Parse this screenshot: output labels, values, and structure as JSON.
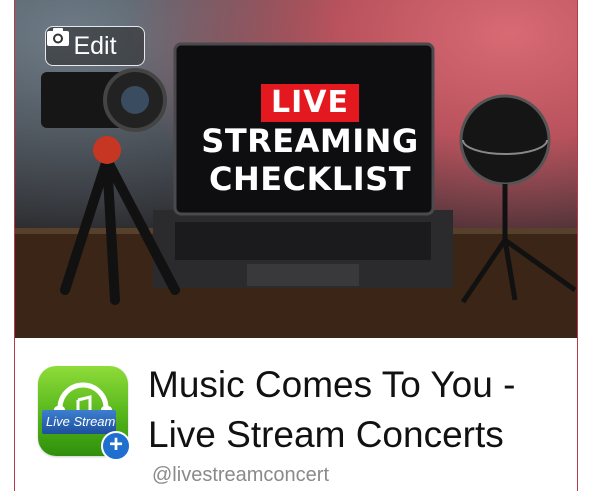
{
  "cover": {
    "edit_label": "Edit",
    "screen_badge": "LIVE",
    "screen_line1": "STREAMING",
    "screen_line2": "CHECKLIST"
  },
  "profile": {
    "icon_text": "Live Stream",
    "plus_symbol": "+",
    "name_line1": "Music Comes To You -",
    "name_line2": "Live Stream Concerts",
    "handle": "@livestreamconcert"
  },
  "icons": {
    "edit": "camera-icon",
    "app": "headphones-music-icon",
    "add": "plus-icon"
  },
  "colors": {
    "frame": "#b73a4a",
    "live_badge": "#e3191f",
    "icon_green": "#55b51a",
    "plus_blue": "#1f6fd1"
  }
}
